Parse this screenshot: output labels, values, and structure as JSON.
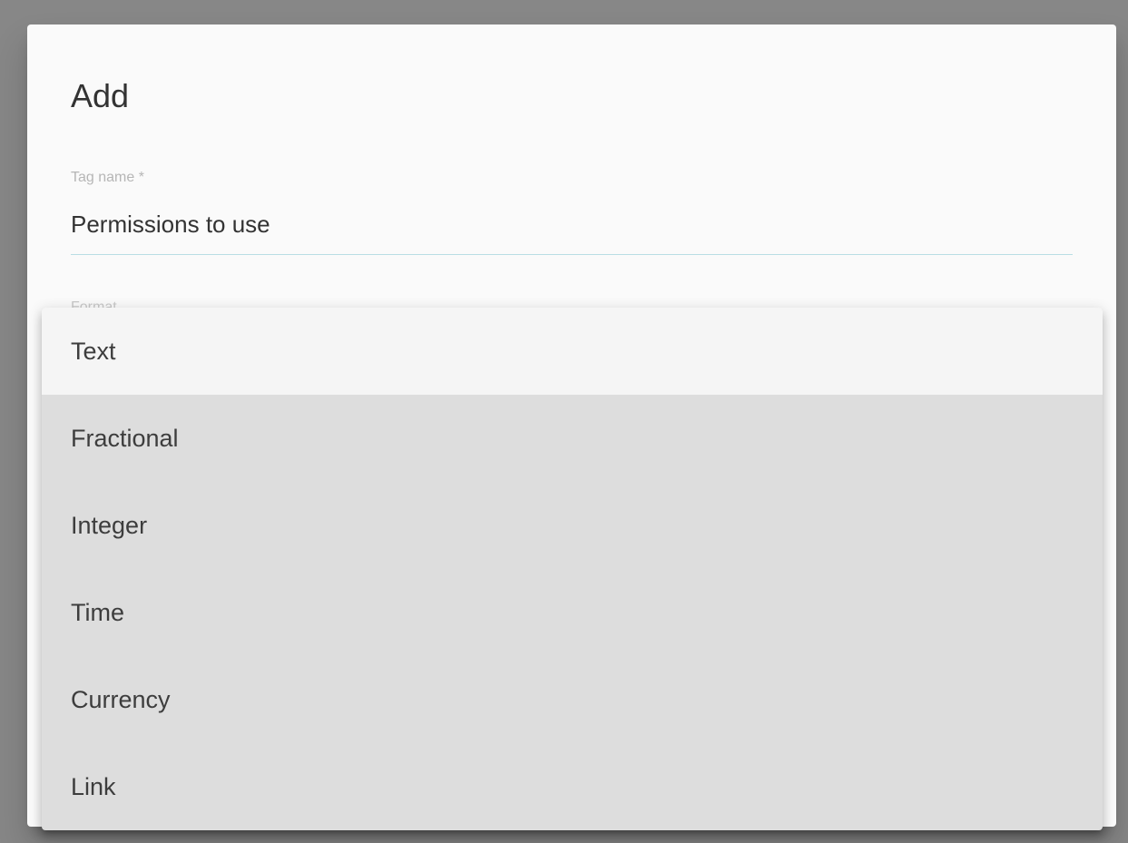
{
  "dialog": {
    "title": "Add",
    "tag_name": {
      "label": "Tag name *",
      "value": "Permissions to use"
    },
    "format": {
      "label": "Format"
    }
  },
  "dropdown": {
    "options": [
      {
        "label": "Text",
        "selected": true
      },
      {
        "label": "Fractional",
        "selected": false
      },
      {
        "label": "Integer",
        "selected": false
      },
      {
        "label": "Time",
        "selected": false
      },
      {
        "label": "Currency",
        "selected": false
      },
      {
        "label": "Link",
        "selected": false
      }
    ]
  },
  "colors": {
    "backdrop": "#878787",
    "dialog_bg": "#fafafa",
    "menu_bg": "#dddddd",
    "selected_option_bg": "#f5f5f5",
    "input_underline": "#b9dde4"
  }
}
